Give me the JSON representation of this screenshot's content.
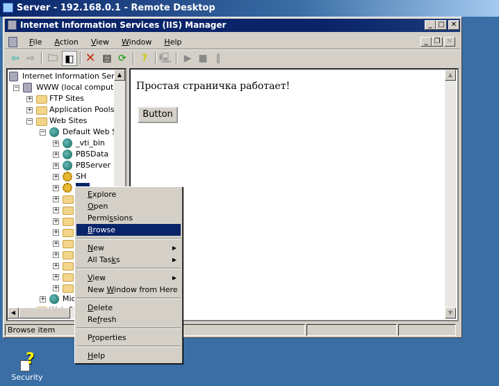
{
  "remote_title": "Server - 192.168.0.1 - Remote Desktop",
  "window_title": "Internet Information Services (IIS) Manager",
  "menu": [
    {
      "u": "F",
      "rest": "ile"
    },
    {
      "u": "A",
      "rest": "ction"
    },
    {
      "u": "V",
      "rest": "iew"
    },
    {
      "u": "W",
      "rest": "indow"
    },
    {
      "u": "H",
      "rest": "elp"
    }
  ],
  "toolbar": [
    "back",
    "forward",
    "up-folder",
    "show-hide-tree",
    "delete",
    "properties",
    "refresh",
    "help",
    "connect",
    "start",
    "stop",
    "pause"
  ],
  "tree": [
    {
      "label": "Internet Information Servic",
      "icon": "iis",
      "level": 0
    },
    {
      "label": "WWW (local computer)",
      "icon": "computer",
      "level": 1,
      "exp": "-"
    },
    {
      "label": "FTP Sites",
      "icon": "folder",
      "level": 2,
      "exp": "+"
    },
    {
      "label": "Application Pools",
      "icon": "folder",
      "level": 2,
      "exp": "+"
    },
    {
      "label": "Web Sites",
      "icon": "folder",
      "level": 2,
      "exp": "-"
    },
    {
      "label": "Default Web Sit",
      "icon": "globe",
      "level": 3,
      "exp": "-"
    },
    {
      "label": "_vti_bin",
      "icon": "globe",
      "level": 4,
      "exp": "+"
    },
    {
      "label": "PBSData",
      "icon": "globe",
      "level": 4,
      "exp": "+"
    },
    {
      "label": "PBServer",
      "icon": "globe",
      "level": 4,
      "exp": "+"
    },
    {
      "label": "SH",
      "icon": "gear",
      "level": 4,
      "exp": "+"
    },
    {
      "label": "???",
      "icon": "gear",
      "level": 4,
      "exp": "+",
      "selected": true
    },
    {
      "label": "",
      "icon": "folder",
      "level": 4,
      "exp": "+"
    },
    {
      "label": "",
      "icon": "folder",
      "level": 4,
      "exp": "+"
    },
    {
      "label": "",
      "icon": "folder",
      "level": 4,
      "exp": "+"
    },
    {
      "label": "",
      "icon": "folder",
      "level": 4,
      "exp": "+"
    },
    {
      "label": "",
      "icon": "folder",
      "level": 4,
      "exp": "+"
    },
    {
      "label": "",
      "icon": "folder",
      "level": 4,
      "exp": "+"
    },
    {
      "label": "",
      "icon": "folder",
      "level": 4,
      "exp": "+"
    },
    {
      "label": "",
      "icon": "folder",
      "level": 4,
      "exp": "+"
    },
    {
      "label": "",
      "icon": "folder",
      "level": 4,
      "exp": "+"
    },
    {
      "label": "Mic",
      "icon": "globe",
      "level": 3,
      "exp": "+"
    },
    {
      "label": "Web Se",
      "icon": "folder",
      "level": 2,
      "exp": "+"
    }
  ],
  "content": {
    "text": "Простая страничка работает!",
    "button": "Button"
  },
  "status": {
    "text": "Browse item"
  },
  "context_menu": [
    {
      "u": "E",
      "pre": "",
      "rest": "xplore"
    },
    {
      "u": "O",
      "pre": "",
      "rest": "pen"
    },
    {
      "u": "s",
      "pre": "Permi",
      "rest": "sions"
    },
    {
      "u": "B",
      "pre": "",
      "rest": "rowse",
      "highlight": true
    },
    {
      "sep": true
    },
    {
      "u": "N",
      "pre": "",
      "rest": "ew",
      "sub": true
    },
    {
      "u": "k",
      "pre": "All Tas",
      "rest": "s",
      "sub": true
    },
    {
      "sep": true
    },
    {
      "u": "V",
      "pre": "",
      "rest": "iew",
      "sub": true
    },
    {
      "u": "W",
      "pre": "New ",
      "rest": "indow from Here"
    },
    {
      "sep": true
    },
    {
      "u": "D",
      "pre": "",
      "rest": "elete"
    },
    {
      "u": "f",
      "pre": "Re",
      "rest": "resh"
    },
    {
      "sep": true
    },
    {
      "u": "r",
      "pre": "P",
      "rest": "operties"
    },
    {
      "sep": true
    },
    {
      "u": "H",
      "pre": "",
      "rest": "elp"
    }
  ],
  "desktop_icon": {
    "label": "Security"
  },
  "colors": {
    "desktop": "#3a6ea5",
    "titlebar": "#0a246a",
    "highlight": "#0a246a",
    "face": "#d4d0c8"
  }
}
